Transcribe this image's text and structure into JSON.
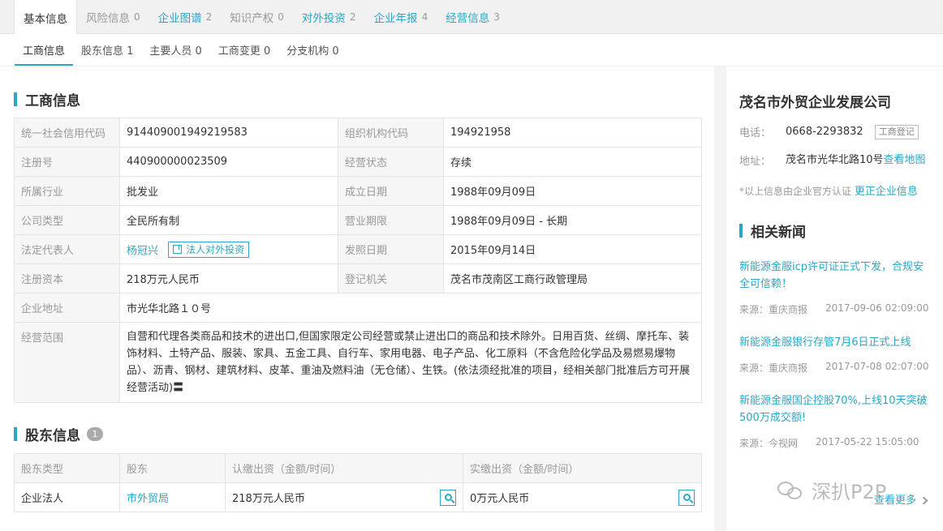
{
  "top_tabs": [
    {
      "label": "基本信息",
      "count": ""
    },
    {
      "label": "风险信息",
      "count": "0"
    },
    {
      "label": "企业图谱",
      "count": "2"
    },
    {
      "label": "知识产权",
      "count": "0"
    },
    {
      "label": "对外投资",
      "count": "2"
    },
    {
      "label": "企业年报",
      "count": "4"
    },
    {
      "label": "经营信息",
      "count": "3"
    }
  ],
  "sub_tabs": [
    {
      "label": "工商信息"
    },
    {
      "label": "股东信息 1"
    },
    {
      "label": "主要人员 0"
    },
    {
      "label": "工商变更 0"
    },
    {
      "label": "分支机构 0"
    }
  ],
  "business_info": {
    "title": "工商信息",
    "credit_code_label": "统一社会信用代码",
    "credit_code": "914409001949219583",
    "org_code_label": "组织机构代码",
    "org_code": "194921958",
    "reg_no_label": "注册号",
    "reg_no": "440900000023509",
    "status_label": "经营状态",
    "status": "存续",
    "industry_label": "所属行业",
    "industry": "批发业",
    "founded_label": "成立日期",
    "founded": "1988年09月09日",
    "company_type_label": "公司类型",
    "company_type": "全民所有制",
    "term_label": "营业期限",
    "term": "1988年09月09日 - 长期",
    "legal_rep_label": "法定代表人",
    "legal_rep": "杨冠兴",
    "legal_rep_invest_btn": "法人对外投资",
    "issue_date_label": "发照日期",
    "issue_date": "2015年09月14日",
    "capital_label": "注册资本",
    "capital": "218万元人民币",
    "authority_label": "登记机关",
    "authority": "茂名市茂南区工商行政管理局",
    "address_label": "企业地址",
    "address": "市光华北路１０号",
    "scope_label": "经营范围",
    "scope": "自营和代理各类商品和技术的进出口,但国家限定公司经营或禁止进出口的商品和技术除外。日用百货、丝绸、摩托车、装饰材料、土特产品、服装、家具、五金工具、自行车、家用电器、电子产品、化工原料（不含危险化学品及易燃易爆物品）、沥青、钢材、建筑材料、皮革、重油及燃料油（无仓储）、生铁。(依法须经批准的项目，经相关部门批准后方可开展经营活动)〓"
  },
  "shareholders": {
    "title": "股东信息",
    "count": "1",
    "headers": [
      "股东类型",
      "股东",
      "认缴出资（金额/时间）",
      "实缴出资（金额/时间）"
    ],
    "rows": [
      {
        "type": "企业法人",
        "name": "市外贸局",
        "subscribed": "218万元人民币",
        "paid": "0万元人民币"
      }
    ]
  },
  "sidebar": {
    "company_name": "茂名市外贸企业发展公司",
    "phone_label": "电话：",
    "phone": "0668-2293832",
    "phone_tag": "工商登记",
    "address_label": "地址：",
    "address": "茂名市光华北路10号",
    "map_link": "查看地图",
    "note": "*以上信息由企业官方认证",
    "correct_link": "更正企业信息",
    "news_title": "相关新闻",
    "news": [
      {
        "title": "新能源金服icp许可证正式下发，合规安全可信赖！",
        "source": "来源：重庆商报",
        "date": "2017-09-06 02:09:00"
      },
      {
        "title": "新能源金服银行存管7月6日正式上线",
        "source": "来源：重庆商报",
        "date": "2017-07-08 02:07:00"
      },
      {
        "title": "新能源金服国企控股70%,上线10天突破500万成交额!",
        "source": "来源：今视网",
        "date": "2017-05-22 15:05:00"
      }
    ],
    "more": "查看更多",
    "watermark": "深扒P2P"
  },
  "colors": {
    "accent": "#2aa7c6",
    "label_bg": "#f6f6f6",
    "border": "#e4e4e4"
  }
}
